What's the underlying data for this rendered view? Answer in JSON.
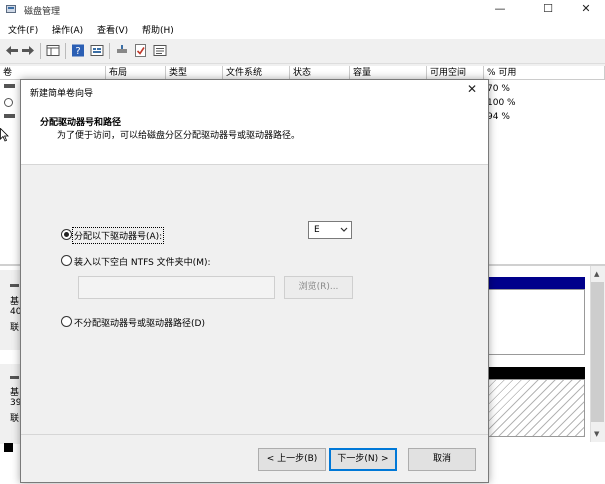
{
  "window": {
    "title": "磁盘管理",
    "controls": [
      "—",
      "☐",
      "✕"
    ]
  },
  "menu": [
    "文件(F)",
    "操作(A)",
    "查看(V)",
    "帮助(H)"
  ],
  "columns": [
    "卷",
    "布局",
    "类型",
    "文件系统",
    "状态",
    "容量",
    "可用空间",
    "% 可用"
  ],
  "volumes": [
    {
      "pct": "70 %"
    },
    {
      "pct": "100 %"
    },
    {
      "pct": "94 %"
    }
  ],
  "disks": [
    {
      "l1": "基",
      "l2": "40",
      "l3": "联"
    },
    {
      "l1": "基",
      "l2": "39",
      "l3": "联"
    }
  ],
  "dialog": {
    "title": "新建简单卷向导",
    "header_title": "分配驱动器号和路径",
    "header_desc": "为了便于访问，可以给磁盘分区分配驱动器号或驱动器路径。",
    "opt_assign": "分配以下驱动器号(A):",
    "opt_mount": "装入以下空白 NTFS 文件夹中(M):",
    "opt_none": "不分配驱动器号或驱动器路径(D)",
    "drive_letter": "E",
    "browse": "浏览(R)...",
    "back": "< 上一步(B)",
    "next": "下一步(N) >",
    "cancel": "取消",
    "close": "✕"
  },
  "colors": {
    "blue_bar": "#00008b",
    "black_bar": "#000000",
    "accent": "#0078d7"
  }
}
